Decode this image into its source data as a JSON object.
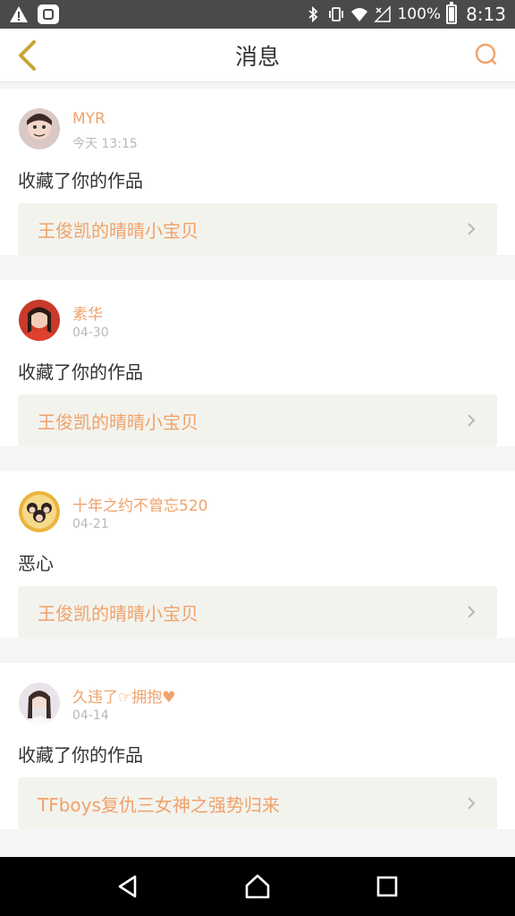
{
  "status_bar": {
    "battery": "100%",
    "time": "8:13",
    "icons": [
      "warning-icon",
      "app-notification-icon",
      "bluetooth-icon",
      "vibrate-icon",
      "wifi-icon",
      "signal-icon",
      "battery-icon"
    ]
  },
  "header": {
    "title": "消息",
    "back_icon": "chevron-left-icon",
    "search_icon": "search-icon"
  },
  "colors": {
    "accent": "#f0a26a",
    "back_icon": "#c8a43a",
    "work_bg": "#f3f3ee"
  },
  "messages": [
    {
      "user": "MYR",
      "time": "今天 13:15",
      "action": "收藏了你的作品",
      "work": "王俊凯的晴晴小宝贝"
    },
    {
      "user": "素华",
      "time": "04-30",
      "action": "收藏了你的作品",
      "work": "王俊凯的晴晴小宝贝"
    },
    {
      "user": "十年之约不曾忘520",
      "time": "04-21",
      "action": "恶心",
      "work": "王俊凯的晴晴小宝贝"
    },
    {
      "user": "久违了☞拥抱♥",
      "time": "04-14",
      "action": "收藏了你的作品",
      "work": "TFboys复仇三女神之强势归来"
    }
  ],
  "nav_bar": {
    "icons": [
      "back-triangle-icon",
      "home-icon",
      "recents-square-icon"
    ]
  }
}
